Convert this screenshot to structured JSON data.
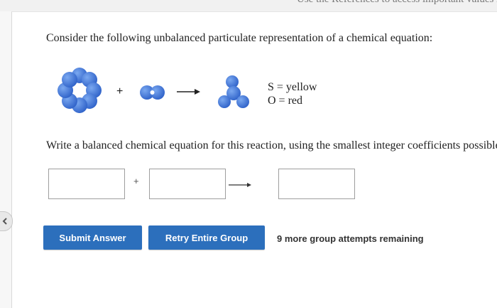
{
  "header": {
    "cut_text": "Use the References to access important values if"
  },
  "question": {
    "text": "Consider the following unbalanced particulate representation of a chemical equation:"
  },
  "equation": {
    "plus": "+"
  },
  "legend": {
    "sulfur": "S = yellow",
    "oxygen": "O = red"
  },
  "instructions": {
    "text": "Write a balanced chemical equation for this reaction, using the smallest integer coefficients possible."
  },
  "answer_row": {
    "plus": "+"
  },
  "buttons": {
    "submit": "Submit Answer",
    "retry": "Retry Entire Group"
  },
  "attempts": {
    "text": "9 more group attempts remaining"
  },
  "colors": {
    "button_blue": "#2c6fbc",
    "molecule_blue": "#3a73d6"
  }
}
